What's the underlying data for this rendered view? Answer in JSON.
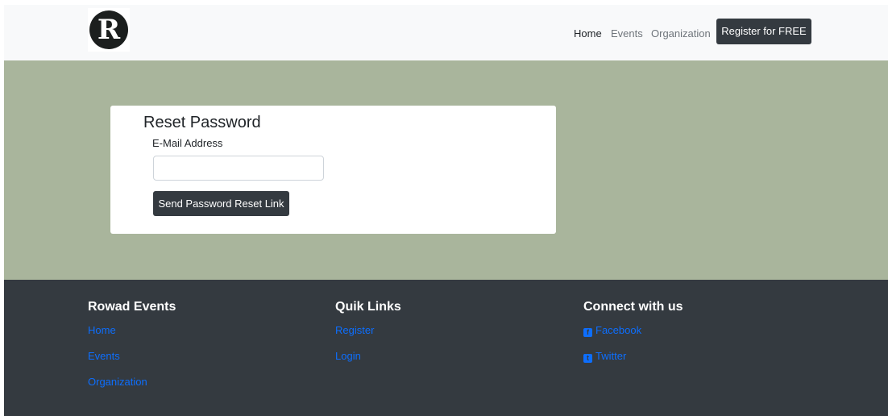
{
  "header": {
    "logo": {
      "letter": "R",
      "icon": "logo-r-circle"
    },
    "nav": [
      {
        "label": "Home",
        "active": true
      },
      {
        "label": "Events",
        "active": false
      },
      {
        "label": "Organization",
        "active": false
      }
    ],
    "cta_label": "Register for FREE"
  },
  "form": {
    "title": "Reset Password",
    "email_label": "E-Mail Address",
    "email_value": "",
    "email_placeholder": "",
    "submit_label": "Send Password Reset Link"
  },
  "footer": {
    "columns": [
      {
        "heading": "Rowad Events",
        "links": [
          "Home",
          "Events",
          "Organization"
        ]
      },
      {
        "heading": "Quik Links",
        "links": [
          "Register",
          "Login"
        ]
      },
      {
        "heading": "Connect with us",
        "links": [
          {
            "label": "Facebook",
            "icon": "facebook-icon"
          },
          {
            "label": "Twitter",
            "icon": "twitter-icon"
          }
        ]
      }
    ]
  },
  "colors": {
    "navbar_bg": "#f8f9fa",
    "hero_bg": "#a9b59c",
    "footer_bg": "#343a40",
    "button_bg": "#343a40",
    "link": "#0d6efd"
  }
}
